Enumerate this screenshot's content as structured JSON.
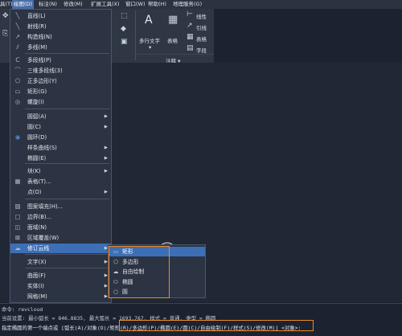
{
  "menubar": {
    "items": [
      {
        "label": "具(T)"
      },
      {
        "label": "绘图(D)"
      },
      {
        "label": "标注(N)"
      },
      {
        "label": "修改(M)"
      },
      {
        "label": "扩展工具(X)"
      },
      {
        "label": "窗口(W)"
      },
      {
        "label": "帮助(H)"
      },
      {
        "label": "地理服务(G)"
      }
    ]
  },
  "ribbon": {
    "multiline_text": "多行文字",
    "table": "表格",
    "linear": "线性",
    "leader": "引线",
    "table_small": "表格",
    "field": "字段",
    "annotation_panel": "注释 ▾"
  },
  "draw_menu": {
    "items": [
      {
        "label": "直线(L)",
        "icon": "line-icon"
      },
      {
        "label": "射线(R)",
        "icon": "ray-icon"
      },
      {
        "label": "构造线(N)",
        "icon": "construction-line-icon"
      },
      {
        "label": "多线(M)",
        "icon": "multiline-icon"
      },
      {
        "label": "多段线(P)",
        "icon": "polyline-icon"
      },
      {
        "label": "三维多段线(3)",
        "icon": "3d-polyline-icon"
      },
      {
        "label": "正多边形(Y)",
        "icon": "polygon-icon"
      },
      {
        "label": "矩形(G)",
        "icon": "rectangle-icon"
      },
      {
        "label": "螺旋(I)",
        "icon": "helix-icon"
      },
      {
        "label": "圆弧(A)",
        "icon": "",
        "submenu": true
      },
      {
        "label": "圆(C)",
        "icon": "",
        "submenu": true
      },
      {
        "label": "圆环(D)",
        "icon": "donut-icon"
      },
      {
        "label": "样条曲线(S)",
        "icon": "",
        "submenu": true
      },
      {
        "label": "椭圆(E)",
        "icon": "",
        "submenu": true
      },
      {
        "label": "块(K)",
        "icon": "",
        "submenu": true
      },
      {
        "label": "表格(T)...",
        "icon": "table-icon"
      },
      {
        "label": "点(O)",
        "icon": "",
        "submenu": true
      },
      {
        "label": "图案填充(H)...",
        "icon": "hatch-icon"
      },
      {
        "label": "边界(B)...",
        "icon": "boundary-icon"
      },
      {
        "label": "面域(N)",
        "icon": "region-icon"
      },
      {
        "label": "区域覆盖(W)",
        "icon": "wipeout-icon"
      },
      {
        "label": "修订云线",
        "icon": "revcloud-icon",
        "submenu": true
      },
      {
        "label": "文字(X)",
        "icon": "",
        "submenu": true
      },
      {
        "label": "曲面(F)",
        "icon": "",
        "submenu": true
      },
      {
        "label": "实体(I)",
        "icon": "",
        "submenu": true
      },
      {
        "label": "网格(M)",
        "icon": "",
        "submenu": true
      }
    ]
  },
  "revcloud_submenu": {
    "items": [
      {
        "label": "矩形"
      },
      {
        "label": "多边形"
      },
      {
        "label": "自由绘制"
      },
      {
        "label": "椭圆"
      },
      {
        "label": "圆"
      }
    ]
  },
  "command_line": {
    "line1": "命令: revcloud",
    "line2": "当前设置: 最小弧长 = 846.8835, 最大弧长 = 1693.767, 样式 = 普通, 类型 = 椭圆",
    "line3": "指定椭圆的第一个端点或 [弧长(A)/对象(O)/矩形(R)/多边形(P)/椭圆(E)/圆(C)/自由绘制(F)/样式(S)/修改(M)] <对象>:"
  },
  "colors": {
    "accent": "#3d6fb6",
    "highlight_box": "#f08a24",
    "menu_bg": "#2c3342",
    "canvas_bg": "#202836"
  }
}
